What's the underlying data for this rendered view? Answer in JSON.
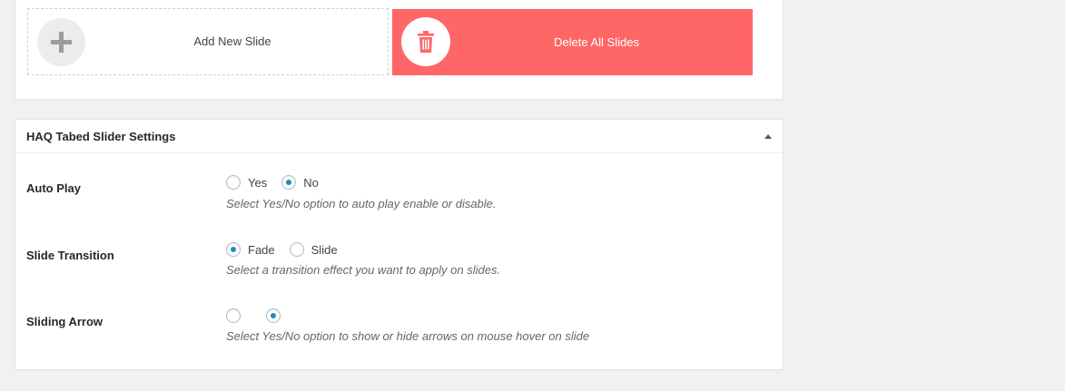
{
  "slides_panel": {
    "add_label": "Add New Slide",
    "delete_label": "Delete All Slides"
  },
  "settings": {
    "title": "HAQ Tabed Slider Settings",
    "rows": [
      {
        "label": "Auto Play",
        "options": [
          {
            "label": "Yes",
            "checked": false
          },
          {
            "label": "No",
            "checked": true
          }
        ],
        "description": "Select Yes/No option to auto play enable or disable."
      },
      {
        "label": "Slide Transition",
        "options": [
          {
            "label": "Fade",
            "checked": true
          },
          {
            "label": "Slide",
            "checked": false
          }
        ],
        "description": "Select a transition effect you want to apply on slides."
      },
      {
        "label": "Sliding Arrow",
        "options": [
          {
            "label": "",
            "checked": false
          },
          {
            "label": "",
            "checked": true
          }
        ],
        "description": "Select Yes/No option to show or hide arrows on mouse hover on slide"
      }
    ]
  },
  "colors": {
    "delete_bg": "#ff6666",
    "radio_checked": "#1e8cbe"
  },
  "icons": {
    "add": "plus-icon",
    "delete": "trash-icon",
    "toggle": "caret-up-icon"
  }
}
